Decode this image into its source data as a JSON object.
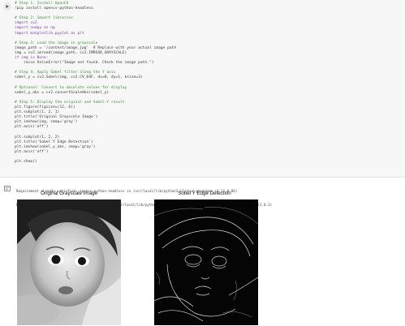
{
  "code_cell": {
    "lines": [
      {
        "t": "# Step 1: Install OpenCV",
        "c": "cm"
      },
      {
        "t": "!pip install opencv-python-headless",
        "c": ""
      },
      {
        "t": "",
        "c": ""
      },
      {
        "t": "# Step 2: Import libraries",
        "c": "cm"
      },
      {
        "t": "import cv2",
        "c": "kw"
      },
      {
        "t": "import numpy as np",
        "c": "kw"
      },
      {
        "t": "import matplotlib.pyplot as plt",
        "c": "kw"
      },
      {
        "t": "",
        "c": ""
      },
      {
        "t": "# Step 3: Load the image in grayscale",
        "c": "cm"
      },
      {
        "t": "image_path = '/content/image_jpg'  # Replace with your actual image path",
        "c": ""
      },
      {
        "t": "img = cv2.imread(image_path, cv2.IMREAD_GRAYSCALE)",
        "c": ""
      },
      {
        "t": "if img is None:",
        "c": "kw"
      },
      {
        "t": "    raise ValueError(\"Image not found. Check the image path.\")",
        "c": ""
      },
      {
        "t": "",
        "c": ""
      },
      {
        "t": "# Step 4: Apply Sobel filter along the Y axis",
        "c": "cm"
      },
      {
        "t": "sobel_y = cv2.Sobel(img, cv2.CV_64F, dx=0, dy=1, ksize=3)",
        "c": ""
      },
      {
        "t": "",
        "c": ""
      },
      {
        "t": "# Optional: Convert to absolute values for display",
        "c": "cm"
      },
      {
        "t": "sobel_y_abs = cv2.convertScaleAbs(sobel_y)",
        "c": ""
      },
      {
        "t": "",
        "c": ""
      },
      {
        "t": "# Step 5: Display the original and Sobel-Y result",
        "c": "cm"
      },
      {
        "t": "plt.figure(figsize=(12, 6))",
        "c": ""
      },
      {
        "t": "plt.subplot(1, 2, 1)",
        "c": ""
      },
      {
        "t": "plt.title('Original Grayscale Image')",
        "c": ""
      },
      {
        "t": "plt.imshow(img, cmap='gray')",
        "c": ""
      },
      {
        "t": "plt.axis('off')",
        "c": ""
      },
      {
        "t": "",
        "c": ""
      },
      {
        "t": "plt.subplot(1, 2, 2)",
        "c": ""
      },
      {
        "t": "plt.title('Sobel Y Edge Detection')",
        "c": ""
      },
      {
        "t": "plt.imshow(sobel_y_abs, cmap='gray')",
        "c": ""
      },
      {
        "t": "plt.axis('off')",
        "c": ""
      },
      {
        "t": "",
        "c": ""
      },
      {
        "t": "plt.show()",
        "c": ""
      }
    ]
  },
  "output": {
    "stdout": [
      "Requirement already satisfied: opencv-python-headless in /usr/local/lib/python3.11/dist-packages (4.11.0.86)",
      "Requirement already satisfied: numpy>=1.21.2 in /usr/local/lib/python3.11/dist-packages (from opencv-python-headless) (2.0.2)"
    ],
    "figure": {
      "left_title": "Original Grayscale Image",
      "right_title": "Sobel Y Edge Detection"
    }
  },
  "icons": {
    "run": "play-icon",
    "output": "output-toggle-icon"
  },
  "colors": {
    "cell_bg": "#f7f7f7",
    "comment": "#3e8f3e",
    "keyword": "#7d3fa8"
  }
}
